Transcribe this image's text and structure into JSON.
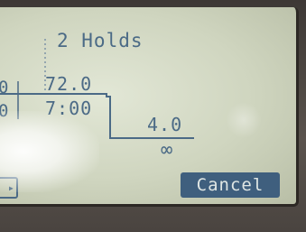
{
  "screen": {
    "title": "2 Holds",
    "edge_values": [
      "0",
      "0"
    ],
    "step1": {
      "temperature": "72.0",
      "time": "7:00"
    },
    "step2": {
      "temperature": "4.0",
      "time_symbol": "∞"
    },
    "left_button_glyph": "▸",
    "cancel_label": "Cancel"
  },
  "colors": {
    "lcd_background": "#d4dac5",
    "lcd_text": "#4b6a86",
    "button_fill": "#3f5f7e",
    "button_text": "#dfe6e4"
  }
}
